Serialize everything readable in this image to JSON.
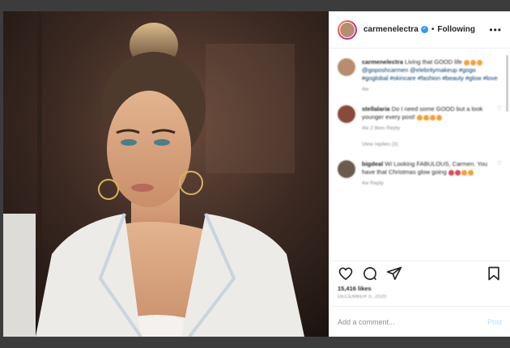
{
  "post": {
    "username": "carmenelectra",
    "separator": "•",
    "follow_label": "Following",
    "more_icon": "more-horizontal-icon"
  },
  "comments": [
    {
      "user": "carmenelectra",
      "text": "Living that GOOD life",
      "tags": "@goposhcarmen @elebritymakeup #gogo #goglobal #skincare #fashion #beauty #glow #love",
      "meta": "4w",
      "avatar_color": "#b88c6e"
    },
    {
      "user": "stellalaria",
      "text": "Do I need some GOOD but a look younger every post!",
      "meta": "4w   2 likes   Reply",
      "replies": "View replies (3)",
      "avatar_color": "#8a4a3a"
    },
    {
      "user": "bigdeal",
      "text": "Wi Looking FABULOUS, Carmen. You have that Christmas glow going",
      "meta": "4w   Reply",
      "avatar_color": "#6b5a4e"
    }
  ],
  "likes_text": "15,416 likes",
  "date_text": "DECEMBER 5, 2020",
  "add_comment": {
    "placeholder": "Add a comment...",
    "post_label": "Post"
  },
  "colors": {
    "accent_link": "#00376b",
    "post_button": "#b2dffc",
    "verified": "#3897f0"
  }
}
